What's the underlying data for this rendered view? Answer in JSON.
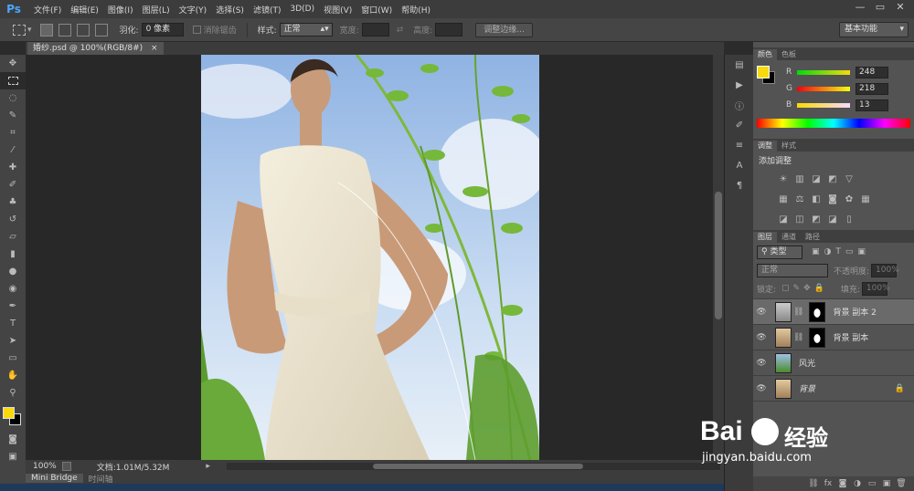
{
  "app": {
    "logo": "Ps"
  },
  "menu": [
    "文件(F)",
    "编辑(E)",
    "图像(I)",
    "图层(L)",
    "文字(Y)",
    "选择(S)",
    "滤镜(T)",
    "3D(D)",
    "视图(V)",
    "窗口(W)",
    "帮助(H)"
  ],
  "window_controls": {
    "minimize": "—",
    "restore": "▭",
    "close": "✕"
  },
  "options": {
    "feather_label": "羽化:",
    "feather_value": "0 像素",
    "antialias_label": "消除锯齿",
    "style_label": "样式:",
    "style_value": "正常",
    "width_label": "宽度:",
    "height_label": "高度:",
    "refine_edge": "调整边缘...",
    "workspace": "基本功能"
  },
  "document": {
    "tab": "婚纱.psd @ 100%(RGB/8#)",
    "close": "×"
  },
  "status": {
    "zoom": "100%",
    "doc_info": "文档:1.01M/5.32M"
  },
  "bottom_tabs": [
    "Mini Bridge",
    "时间轴"
  ],
  "color_panel": {
    "tabs": [
      "颜色",
      "色板"
    ],
    "r_label": "R",
    "r": "248",
    "g_label": "G",
    "g": "218",
    "b_label": "B",
    "b": "13",
    "foreground": "#f8da0d"
  },
  "adjust_panel": {
    "tabs": [
      "调整",
      "样式"
    ],
    "title": "添加调整"
  },
  "layers_panel": {
    "tabs": [
      "图层",
      "通道",
      "路径"
    ],
    "filter": "类型",
    "blend": "正常",
    "opacity_label": "不透明度:",
    "opacity": "100%",
    "lock_label": "锁定:",
    "fill_label": "填充:",
    "fill": "100%",
    "layers": [
      {
        "name": "背景 副本 2"
      },
      {
        "name": "背景 副本"
      },
      {
        "name": "风光"
      },
      {
        "name": "背景"
      }
    ]
  },
  "watermark": {
    "brand": "Bai",
    "brand2": "经验",
    "url": "jingyan.baidu.com"
  },
  "colors": {
    "accent": "#f8da0d",
    "panel": "#535353",
    "bg": "#2b2b2b"
  }
}
